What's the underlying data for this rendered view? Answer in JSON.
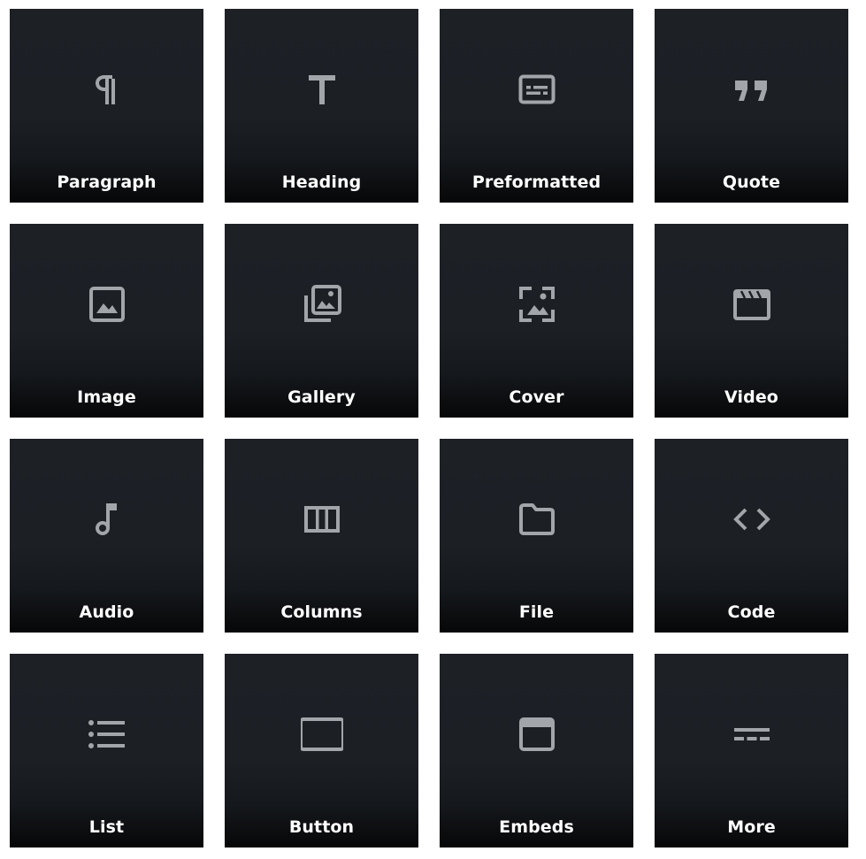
{
  "blocks": [
    {
      "label": "Paragraph",
      "icon": "paragraph-icon"
    },
    {
      "label": "Heading",
      "icon": "heading-icon"
    },
    {
      "label": "Preformatted",
      "icon": "preformatted-icon"
    },
    {
      "label": "Quote",
      "icon": "quote-icon"
    },
    {
      "label": "Image",
      "icon": "image-icon"
    },
    {
      "label": "Gallery",
      "icon": "gallery-icon"
    },
    {
      "label": "Cover",
      "icon": "cover-icon"
    },
    {
      "label": "Video",
      "icon": "video-icon"
    },
    {
      "label": "Audio",
      "icon": "audio-icon"
    },
    {
      "label": "Columns",
      "icon": "columns-icon"
    },
    {
      "label": "File",
      "icon": "file-icon"
    },
    {
      "label": "Code",
      "icon": "code-icon"
    },
    {
      "label": "List",
      "icon": "list-icon"
    },
    {
      "label": "Button",
      "icon": "button-icon"
    },
    {
      "label": "Embeds",
      "icon": "embeds-icon"
    },
    {
      "label": "More",
      "icon": "more-icon"
    }
  ],
  "colors": {
    "tile_top": "#1d2126",
    "tile_bottom": "#060708",
    "icon": "#a2a6ab",
    "label": "#ffffff",
    "background": "#ffffff"
  }
}
